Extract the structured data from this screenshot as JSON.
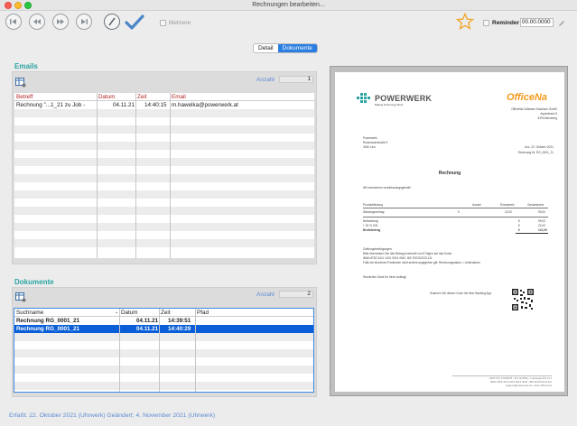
{
  "window": {
    "title": "Rechnungen bearbeiten..."
  },
  "toolbar": {
    "mehrere_label": "Mehrere",
    "reminder_label": "Reminder",
    "reminder_value": "00.00.0000"
  },
  "tabs": {
    "detail": "Detail",
    "dokumente": "Dokumente"
  },
  "emails": {
    "title": "Emails",
    "anzahl_label": "Anzahl",
    "count": "1",
    "columns": [
      "Betreff",
      "Datum",
      "Zeit",
      "Email"
    ],
    "rows": [
      {
        "betreff": "Rechnung \"...1_21 zu Job -",
        "datum": "04.11.21",
        "zeit": "14:40:15",
        "email": "m.hawelka@powerwerk.at"
      }
    ]
  },
  "dokumente": {
    "title": "Dokumente",
    "anzahl_label": "Anzahl",
    "count": "2",
    "columns": [
      "Suchname",
      "Datum",
      "Zeit",
      "Pfad"
    ],
    "rows": [
      {
        "suchname": "Rechnung RG_0001_21",
        "datum": "04.11.21",
        "zeit": "14:39:51",
        "pfad": ""
      },
      {
        "suchname": "Rechnung RG_0001_21",
        "datum": "04.11.21",
        "zeit": "14:40:29",
        "pfad": ""
      }
    ]
  },
  "status": {
    "text": "Erfaßt: 22. Oktober 2021 (Uhrwerk)   Geändert: 4. November 2021 (Uhrwerk)"
  },
  "invoice": {
    "logo_left": "POWERWERK",
    "logo_left_sub": "Making Technology Work",
    "logo_right": "OfficeNa",
    "company_line1": "OfficeNa! Software Solutions GmbH",
    "company_line2": "Aspenbach 5",
    "company_line3": "4293 Altenberg",
    "recipient1": "Powerwerk",
    "recipient2": "Rosenauerstraße 9",
    "recipient3": "4040 Linz",
    "date_line": "Linz, 22. Oktober 2021",
    "number_line": "Rechnung Nr. RG_0001_21",
    "heading": "Rechnung",
    "intro": "Wir verrechnen vereinbarungsgemäß:",
    "table_headers": [
      "Produktleistung",
      "Anzahl",
      "Einzelpreis",
      "Gesamtpreis"
    ],
    "item": [
      "Wartungsvertrag",
      "9",
      "22,00",
      "99,00"
    ],
    "net_label": "Nettobetrag",
    "net_value": "99,00",
    "vat_label": "+ 20 % USt.",
    "vat_value": "22,00",
    "gross_label": "Bruttobetrag",
    "gross_value": "121,00",
    "terms1": "Zahlungsbedingungen:",
    "terms2": "Bitte überweisen Sie den Betrag innerhalb von 8 Tagen auf das Konto",
    "terms3": "IBAN AT82 3411 1001 0014 4042, BIC RZOOAT2L111",
    "terms4": "Falls bei einzelnen Positionen nicht anders angegeben gilt: Rechnungsdatum = Lieferdatum.",
    "thanks": "Herzlichen Dank für Ihren Auftrag!",
    "scan": "Scannen Sie diesen Code mit Ihrer Banking App",
    "footer1": "UID# ATU 12345678 • FN 123456y • Landesgericht Linz",
    "footer2": "IBAN AT82 3411 1001 0014 4042 • BIC RZOOAT2L111",
    "footer3": "support@powerwerk.at • www.officena.at"
  },
  "colors": {
    "accent": "#2a7de1",
    "section": "#2aa3a3",
    "selection": "#0a5fd8",
    "logo_orange": "#f39a1e",
    "logo_teal": "#2aa3a3"
  },
  "icons": [
    "first-record-icon",
    "previous-record-icon",
    "next-record-icon",
    "last-record-icon",
    "cancel-icon",
    "confirm-check-icon",
    "favorite-star-icon",
    "edit-pencil-icon",
    "table-settings-icon"
  ]
}
